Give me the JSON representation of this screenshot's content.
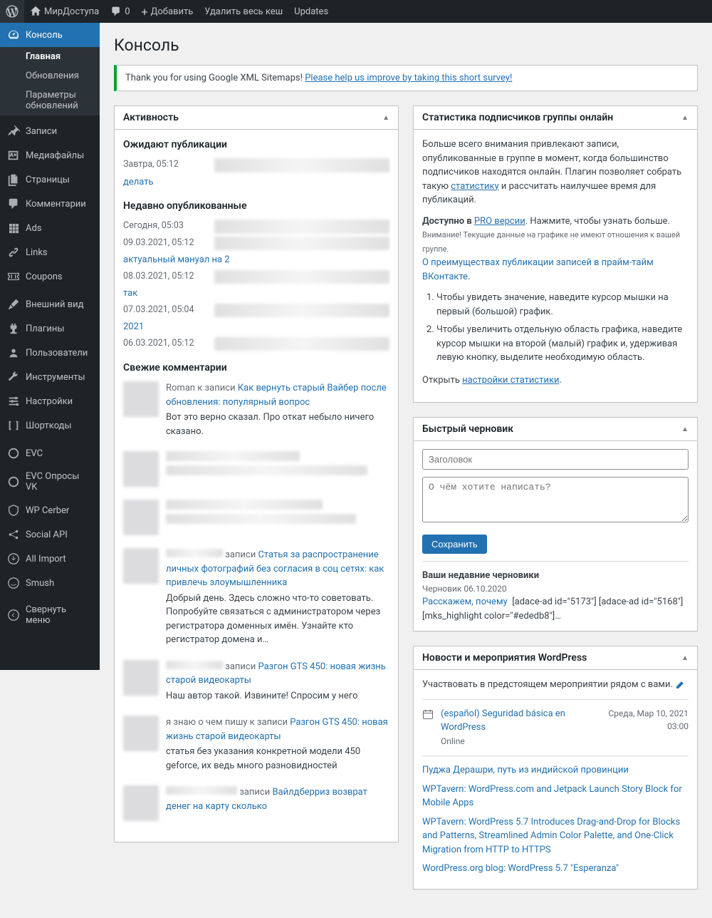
{
  "topbar": {
    "site_name": "МирДоступа",
    "comments": "0",
    "add_new": "Добавить",
    "purge_cache": "Удалить весь кеш",
    "updates": "Updates"
  },
  "sidebar": {
    "console": "Консоль",
    "sub_main": "Главная",
    "sub_updates": "Обновления",
    "sub_update_params": "Параметры обновлений",
    "posts": "Записи",
    "media": "Медиафайлы",
    "pages": "Страницы",
    "comments": "Комментарии",
    "ads": "Ads",
    "links": "Links",
    "coupons": "Coupons",
    "appearance": "Внешний вид",
    "plugins": "Плагины",
    "users": "Пользователи",
    "tools": "Инструменты",
    "settings": "Настройки",
    "shortcodes": "Шорткоды",
    "evc": "EVC",
    "evc_polls": "EVC Опросы VK",
    "wp_cerber": "WP Cerber",
    "social_api": "Social API",
    "all_import": "All Import",
    "smush": "Smush",
    "collapse": "Свернуть меню"
  },
  "page_title": "Консоль",
  "notice": {
    "text": "Thank you for using Google XML Sitemaps! ",
    "link": "Please help us improve by taking this short survey!"
  },
  "activity": {
    "title": "Активность",
    "pending_title": "Ожидают публикации",
    "pending": [
      {
        "date": "Завтра, 05:12",
        "link": "делать"
      }
    ],
    "recent_title": "Недавно опубликованные",
    "recent": [
      {
        "date": "Сегодня, 05:03"
      },
      {
        "date": "09.03.2021, 05:12",
        "link": "актуальный мануал на 2"
      },
      {
        "date": "08.03.2021, 05:12",
        "link": "так"
      },
      {
        "date": "07.03.2021, 05:04",
        "link": "2021"
      },
      {
        "date": "06.03.2021, 05:12"
      }
    ],
    "comments_title": "Свежие комментарии",
    "comments": [
      {
        "author": "Roman",
        "to": " к записи ",
        "post": "Как вернуть старый Вайбер после обновления: популярный вопрос",
        "text": "Вот это верно сказал. Про откат небыло ничего сказано."
      },
      {
        "meta": "■■■■■■■■",
        "text": "■■■■■■■■■■■■■■■■■■■■■■■■■■■■■■"
      },
      {
        "meta": "■■■■■■■■",
        "text": "■■■■■■■■■■■■■■■■■■■■"
      },
      {
        "to": " записи ",
        "post": "Статья за распространение личных фотографий без согласия в соц сетях: как привлечь злоумышленника",
        "text": "Добрый день. Здесь сложно что-то советовать. Попробуйте связаться с администратором через регистратора доменных имён. Узнайте кто регистратор домена и…"
      },
      {
        "to": " записи ",
        "post": "Разгон GTS 450: новая жизнь старой видеокарты",
        "text": "Наш автор такой. Извините! Спросим у него"
      },
      {
        "meta": "я знаю о чем пишу к записи ",
        "post": "Разгон GTS 450: новая жизнь старой видеокарты",
        "text": "статья без указания конкретной модели 450 geforce, их ведь много разновидностей"
      },
      {
        "to": " записи ",
        "post": "Вайлдберриз возврат денег на карту сколько"
      }
    ]
  },
  "stats": {
    "title": "Статистика подписчиков группы онлайн",
    "p1a": "Больше всего внимания привлекают записи, опубликованные в группе в момент, когда большинство подписчиков находятся онлайн. Плагин позволяет собрать такую ",
    "p1link": "статистику",
    "p1b": " и рассчитать наилучшее время для публикаций.",
    "avail": "Доступно в ",
    "pro": "PRO версии",
    "avail2": ". Нажмите, чтобы узнать больше.",
    "notice": "Внимание! Текущие данные на графике не имеют отношения к вашей группе.",
    "adv_link": "О преимуществах публикации записей в прайм-тайм ВКонтакте",
    "li1": "Чтобы увидеть значение, наведите курсор мышки на первый (большой) график.",
    "li2": "Чтобы увеличить отдельную область графика, наведите курсор мышки на второй (малый) график и, удерживая левую кнопку, выделите необходимую область.",
    "open": "Открыть ",
    "open_link": "настройки статистики"
  },
  "draft": {
    "title": "Быстрый черновик",
    "title_ph": "Заголовок",
    "content_ph": "О чём хотите написать?",
    "save": "Сохранить",
    "recent_title": "Ваши недавние черновики",
    "recent_link": "Расскажем, почему",
    "recent_date": "Черновик 06.10.2020",
    "recent_excerpt": "[adace-ad id=\"5173\"] [adace-ad id=\"5168\"]   [mks_highlight color=\"#ededb8\"]…"
  },
  "news": {
    "title": "Новости и мероприятия WordPress",
    "near_text": "Участвовать в предстоящем мероприятии рядом с вами.",
    "event": {
      "title": "(español) Seguridad básica en WordPress",
      "loc": "Online",
      "when1": "Среда, Мар 10, 2021",
      "when2": "03:00"
    },
    "items": [
      "Пуджа Дерашри, путь из индийской провинции",
      "WPTavern: WordPress.com and Jetpack Launch Story Block for Mobile Apps",
      "WPTavern: WordPress 5.7 Introduces Drag-and-Drop for Blocks and Patterns, Streamlined Admin Color Palette, and One-Click Migration from HTTP to HTTPS",
      "WordPress.org blog: WordPress 5.7 \"Esperanza\""
    ]
  }
}
